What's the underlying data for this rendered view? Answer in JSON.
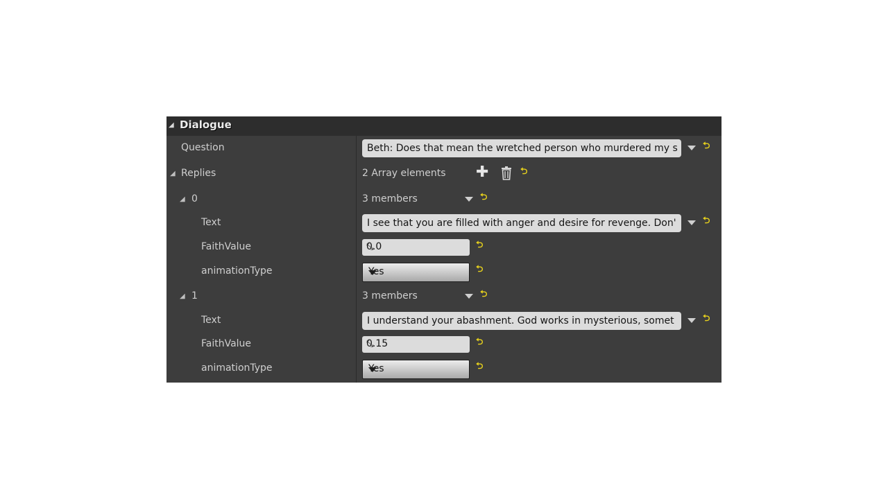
{
  "category": {
    "title": "Dialogue"
  },
  "question": {
    "label": "Question",
    "value": "Beth: Does that mean the wretched person who murdered my s"
  },
  "replies": {
    "label": "Replies",
    "count_text": "2 Array elements",
    "elements": [
      {
        "index": "0",
        "members_text": "3 members",
        "text_label": "Text",
        "text_value": "I see that you are filled with anger and desire for revenge. Don'",
        "faith_label": "FaithValue",
        "faith_value": "0.0",
        "anim_label": "animationType",
        "anim_value": "Yes"
      },
      {
        "index": "1",
        "members_text": "3 members",
        "text_label": "Text",
        "text_value": "I understand your abashment. God works in mysterious, somet",
        "faith_label": "FaithValue",
        "faith_value": "0.15",
        "anim_label": "animationType",
        "anim_value": "Yes"
      }
    ]
  },
  "colors": {
    "panel_bg": "#3d3d3d",
    "header_bg": "#2d2d2d",
    "reset_arrow": "#e8d21c",
    "field_bg": "#dcdcdc"
  },
  "icons": {
    "collapse": "collapse-triangle-icon",
    "reset": "reset-to-default-icon",
    "add": "plus-icon",
    "delete": "trash-icon"
  }
}
